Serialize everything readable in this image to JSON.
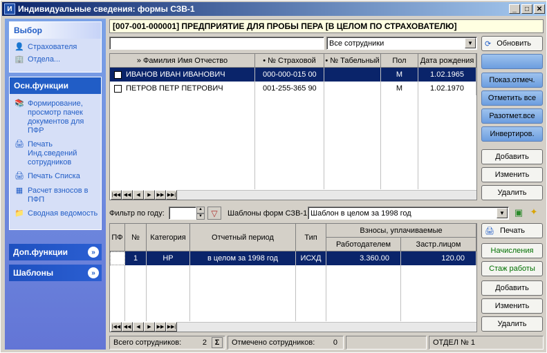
{
  "window": {
    "title": "Индивидуальные сведения: формы СЗВ-1",
    "app_icon": "И"
  },
  "sidebar": {
    "vybor": {
      "title": "Выбор",
      "items": [
        {
          "label": "Страхователя",
          "icon": "person-icon"
        },
        {
          "label": "Отдела...",
          "icon": "org-icon"
        }
      ]
    },
    "osn": {
      "title": "Осн.функции",
      "items": [
        {
          "label": "Формирование, просмотр пачек документов для ПФР",
          "icon": "files-icon"
        },
        {
          "label": "Печать Инд.сведений сотрудников",
          "icon": "printer-icon"
        },
        {
          "label": "Печать Списка",
          "icon": "printer-icon"
        },
        {
          "label": "Расчет взносов в ПФП",
          "icon": "calculator-icon"
        },
        {
          "label": "Сводная ведомость",
          "icon": "folder-icon"
        }
      ]
    },
    "dop": {
      "title": "Доп.функции"
    },
    "shablony": {
      "title": "Шаблоны"
    }
  },
  "org_header": "[007-001-000001] ПРЕДПРИЯТИЕ ДЛЯ ПРОБЫ ПЕРА [В ЦЕЛОМ ПО СТРАХОВАТЕЛЮ]",
  "filter": {
    "search_value": "",
    "employees_select": "Все сотрудники"
  },
  "buttons_top": {
    "refresh": "Обновить",
    "show_marked": "Показ.отмеч.",
    "mark_all": "Отметить все",
    "unmark_all": "Разотмет.все",
    "invert": "Инвертиров.",
    "add": "Добавить",
    "edit": "Изменить",
    "delete": "Удалить"
  },
  "employees": {
    "columns": [
      "» Фамилия Имя Отчество",
      "• № Страховой",
      "• № Табельный",
      "Пол",
      "Дата рождения"
    ],
    "rows": [
      {
        "name": "ИВАНОВ ИВАН ИВАНОВИЧ",
        "ins": "000-000-015 00",
        "tab": "",
        "sex": "М",
        "dob": "1.02.1965"
      },
      {
        "name": "ПЕТРОВ ПЕТР ПЕТРОВИЧ",
        "ins": "001-255-365 90",
        "tab": "",
        "sex": "М",
        "dob": "1.02.1970"
      }
    ]
  },
  "year_filter": {
    "label": "Фильтр по году:",
    "value": ""
  },
  "templates": {
    "label": "Шаблоны форм СЗВ-1:",
    "value": "Шаблон в целом за 1998 год"
  },
  "forms": {
    "columns": {
      "pf": "ПФ",
      "num": "№",
      "cat": "Категория",
      "period": "Отчетный период",
      "type": "Тип",
      "fees": "Взносы, уплачиваемые",
      "employer": "Работодателем",
      "insured": "Застр.лицом"
    },
    "rows": [
      {
        "num": "1",
        "cat": "НР",
        "period": "в целом за 1998 год",
        "type": "ИСХД",
        "employer": "3.360.00",
        "insured": "120.00"
      }
    ]
  },
  "buttons_bottom": {
    "print": "Печать",
    "accruals": "Начисления",
    "experience": "Стаж работы",
    "add": "Добавить",
    "edit": "Изменить",
    "delete": "Удалить"
  },
  "statusbar": {
    "total_label": "Всего сотрудников:",
    "total": "2",
    "sum_icon": "Σ",
    "marked_label": "Отмечено сотрудников:",
    "marked": "0",
    "dept": "ОТДЕЛ № 1"
  },
  "colors": {
    "selection": "#0a246a",
    "sidebar": "#6375d6",
    "header_bg": "#ffffe1"
  }
}
